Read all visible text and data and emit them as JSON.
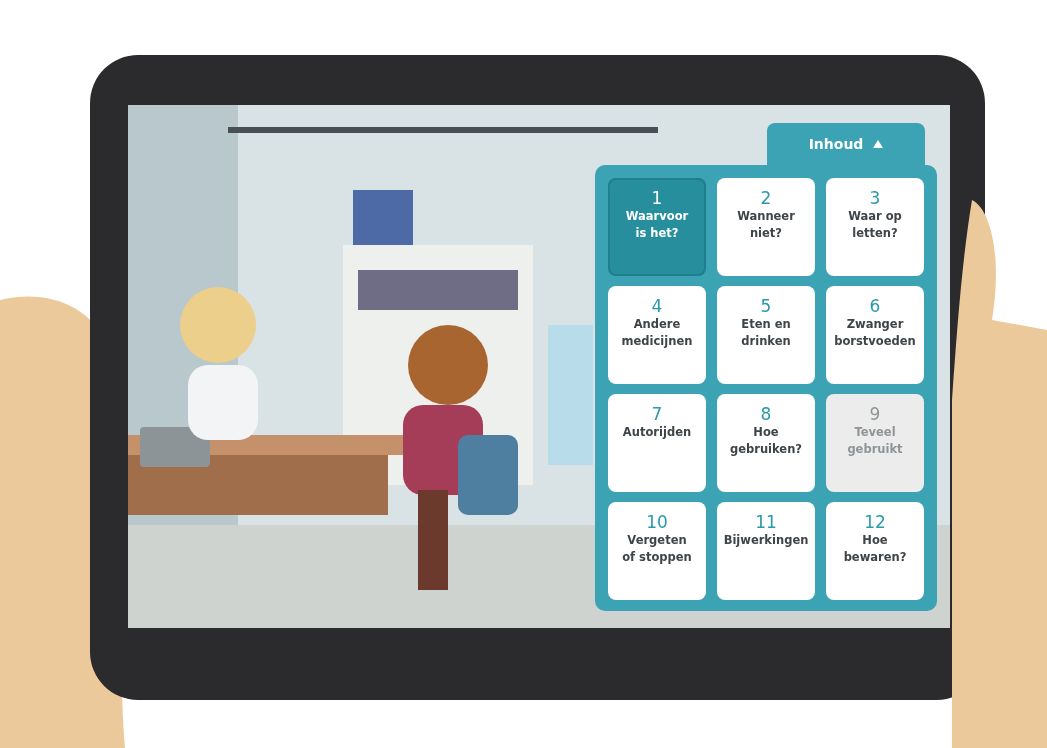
{
  "menu": {
    "title": "Inhoud",
    "expanded": true,
    "tiles": [
      {
        "number": "1",
        "label": "Waarvoor\nis het?",
        "selected": true,
        "disabled": false
      },
      {
        "number": "2",
        "label": "Wanneer\nniet?",
        "selected": false,
        "disabled": false
      },
      {
        "number": "3",
        "label": "Waar op\nletten?",
        "selected": false,
        "disabled": false
      },
      {
        "number": "4",
        "label": "Andere\nmedicijnen",
        "selected": false,
        "disabled": false
      },
      {
        "number": "5",
        "label": "Eten en\ndrinken",
        "selected": false,
        "disabled": false
      },
      {
        "number": "6",
        "label": "Zwanger\nborstvoeden",
        "selected": false,
        "disabled": false
      },
      {
        "number": "7",
        "label": "Autorijden",
        "selected": false,
        "disabled": false
      },
      {
        "number": "8",
        "label": "Hoe\ngebruiken?",
        "selected": false,
        "disabled": false
      },
      {
        "number": "9",
        "label": "Teveel\ngebruikt",
        "selected": false,
        "disabled": true
      },
      {
        "number": "10",
        "label": "Vergeten\nof stoppen",
        "selected": false,
        "disabled": false
      },
      {
        "number": "11",
        "label": "Bijwerkingen",
        "selected": false,
        "disabled": false
      },
      {
        "number": "12",
        "label": "Hoe\nbewaren?",
        "selected": false,
        "disabled": false
      }
    ]
  }
}
